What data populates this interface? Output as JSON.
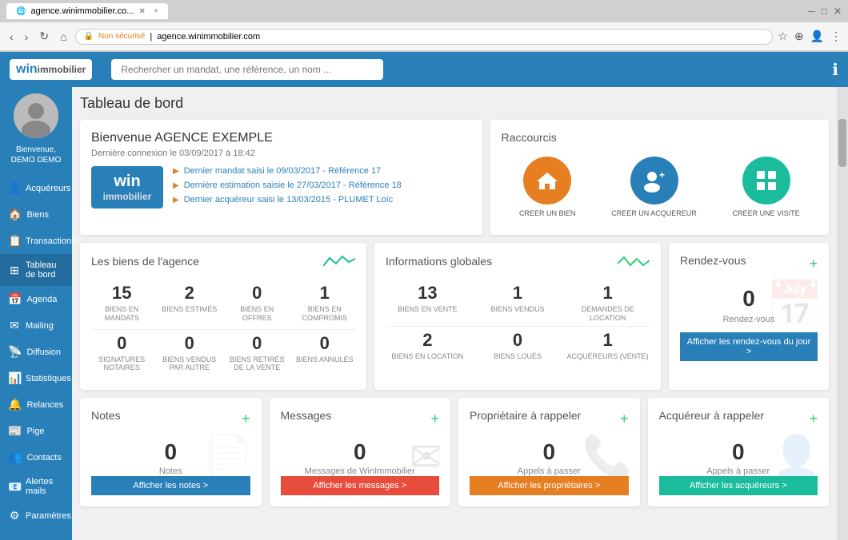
{
  "browser": {
    "tab_title": "agence.winimmobilier.co...",
    "address": "agence.winimmobilier.com",
    "security_label": "Non sécurisé"
  },
  "top_nav": {
    "logo_win": "win",
    "logo_immo": "immobilier",
    "search_placeholder": "Rechercher un mandat, une référence, un nom ...",
    "info_icon": "ℹ"
  },
  "sidebar": {
    "user_greeting": "Bienvenue, DEMO DEMO",
    "items": [
      {
        "label": "Acquéreurs",
        "icon": "👤"
      },
      {
        "label": "Biens",
        "icon": "🏠"
      },
      {
        "label": "Transactions",
        "icon": "📋"
      },
      {
        "label": "Tableau de bord",
        "icon": "⊞"
      },
      {
        "label": "Agenda",
        "icon": "📅"
      },
      {
        "label": "Mailing",
        "icon": "✉"
      },
      {
        "label": "Diffusion",
        "icon": "📡"
      },
      {
        "label": "Statistiques",
        "icon": "📊"
      },
      {
        "label": "Relances",
        "icon": "🔔"
      },
      {
        "label": "Pige",
        "icon": "📰"
      },
      {
        "label": "Contacts",
        "icon": "👥"
      },
      {
        "label": "Alertes mails",
        "icon": "📧"
      },
      {
        "label": "Paramètres",
        "icon": "⚙"
      }
    ]
  },
  "page": {
    "title": "Tableau de bord"
  },
  "welcome": {
    "title": "Bienvenue AGENCE EXEMPLE",
    "last_login": "Dernière connexion le 03/09/2017 à 18:42",
    "links": [
      "Dernier mandat saisi le 09/03/2017 - Référence 17",
      "Dernière estimation saisie le 27/03/2017 - Référence 18",
      "Dernier acquéreur saisi le 13/03/2015 - PLUMET Loïc"
    ]
  },
  "shortcuts": {
    "title": "Raccourcis",
    "items": [
      {
        "label": "CREER UN BIEN",
        "color": "orange",
        "icon": "🏠"
      },
      {
        "label": "CREER UN ACQUEREUR",
        "color": "blue",
        "icon": "👤+"
      },
      {
        "label": "CREER UNE VISITE",
        "color": "teal",
        "icon": "⊞"
      }
    ]
  },
  "biens_agence": {
    "title": "Les biens de l'agence",
    "stats_row1": [
      {
        "value": "15",
        "label": "BIENS EN MANDATS"
      },
      {
        "value": "2",
        "label": "BIENS ESTIMÉS"
      },
      {
        "value": "0",
        "label": "BIENS EN OFFRES"
      },
      {
        "value": "1",
        "label": "BIENS EN COMPROMIS"
      }
    ],
    "stats_row2": [
      {
        "value": "0",
        "label": "SIGNATURES NOTAIRES"
      },
      {
        "value": "0",
        "label": "BIENS VENDUS PAR AUTRE"
      },
      {
        "value": "0",
        "label": "BIENS RETIRÉS DE LA VENTE"
      },
      {
        "value": "0",
        "label": "BIENS ANNULÉS"
      }
    ]
  },
  "infos_globales": {
    "title": "Informations globales",
    "stats_row1": [
      {
        "value": "13",
        "label": "BIENS EN VENTE"
      },
      {
        "value": "1",
        "label": "BIENS VENDUS"
      },
      {
        "value": "1",
        "label": "DEMANDES DE LOCATION"
      }
    ],
    "stats_row2": [
      {
        "value": "2",
        "label": "BIENS EN LOCATION"
      },
      {
        "value": "0",
        "label": "BIENS LOUÉS"
      },
      {
        "value": "1",
        "label": "ACQUÉREURS (VENTE)"
      }
    ]
  },
  "rendez_vous": {
    "title": "Rendez-vous",
    "value": "0",
    "label": "Rendez-vous",
    "btn_label": "Afficher les rendez-vous du jour >"
  },
  "notes": {
    "title": "Notes",
    "value": "0",
    "label": "Notes",
    "btn_label": "Afficher les notes >"
  },
  "messages": {
    "title": "Messages",
    "value": "0",
    "label": "Messages de WinImmobilier",
    "btn_label": "Afficher les messages >"
  },
  "proprietaire": {
    "title": "Propriétaire à rappeler",
    "value": "0",
    "label": "Appels à passer",
    "btn_label": "Afficher les propriétaires >"
  },
  "acquereur": {
    "title": "Acquéreur à rappeler",
    "value": "0",
    "label": "Appels à passer",
    "btn_label": "Afficher les acquéreurs >"
  }
}
